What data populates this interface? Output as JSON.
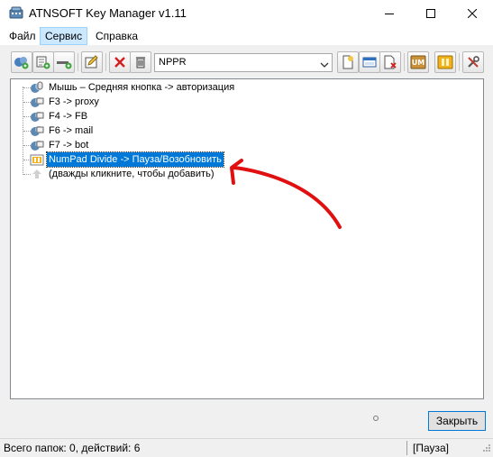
{
  "window": {
    "title": "ATNSOFT Key Manager v1.11",
    "minimize_icon": "minimize-icon",
    "maximize_icon": "maximize-icon",
    "close_icon": "close-icon"
  },
  "menu": {
    "items": [
      {
        "label": "Файл"
      },
      {
        "label": "Сервис",
        "active": true
      },
      {
        "label": "Справка"
      }
    ]
  },
  "toolbar": {
    "buttons": [
      {
        "icon": "add-folder-icon"
      },
      {
        "icon": "add-action-icon"
      },
      {
        "icon": "add-separator-icon"
      },
      {
        "icon": "edit-icon"
      },
      {
        "icon": "delete-icon"
      },
      {
        "icon": "trash-icon"
      },
      {
        "icon": "new-document-icon"
      },
      {
        "icon": "window-properties-icon"
      },
      {
        "icon": "remove-document-icon"
      },
      {
        "icon": "um-icon"
      },
      {
        "icon": "pause-icon"
      },
      {
        "icon": "settings-tools-icon"
      }
    ],
    "profile_selected": "NPPR"
  },
  "tree": {
    "items": [
      {
        "label": "Мышь – Средняя кнопка -> авторизация",
        "icon": "mouse-action-icon",
        "selected": false
      },
      {
        "label": "F3 -> proxy",
        "icon": "key-action-icon",
        "selected": false
      },
      {
        "label": "F4 -> FB",
        "icon": "key-action-icon",
        "selected": false
      },
      {
        "label": "F6 -> mail",
        "icon": "key-action-icon",
        "selected": false
      },
      {
        "label": "F7 -> bot",
        "icon": "key-action-icon",
        "selected": false
      },
      {
        "label": "NumPad Divide -> Пауза/Возобновить",
        "icon": "pause-action-icon",
        "selected": true
      },
      {
        "label": "(дважды кликните, чтобы добавить)",
        "icon": "add-placeholder-icon",
        "selected": false
      }
    ]
  },
  "buttons": {
    "close_label": "Закрыть"
  },
  "status": {
    "left": "Всего папок: 0, действий: 6",
    "right": "[Пауза]"
  },
  "colors": {
    "selection": "#0078d7",
    "annotation_arrow": "#e01010"
  }
}
